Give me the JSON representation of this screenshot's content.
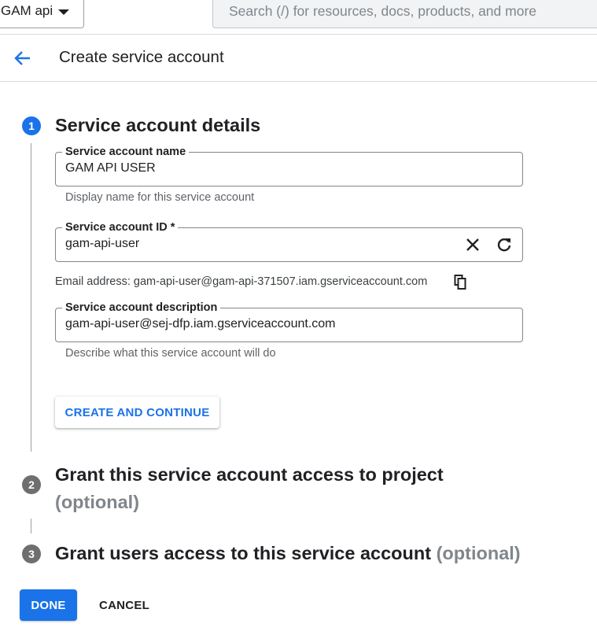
{
  "topbar": {
    "project_name": "GAM api",
    "search_placeholder": "Search (/) for resources, docs, products, and more"
  },
  "header": {
    "title": "Create service account"
  },
  "steps": [
    {
      "number": "1",
      "title": "Service account details"
    },
    {
      "number": "2",
      "title": "Grant this service account access to project",
      "optional": "(optional)"
    },
    {
      "number": "3",
      "title": "Grant users access to this service account",
      "optional": "(optional)"
    }
  ],
  "form": {
    "name": {
      "label": "Service account name",
      "value": "GAM API USER",
      "helper": "Display name for this service account"
    },
    "id": {
      "label": "Service account ID *",
      "value": "gam-api-user"
    },
    "email_line": "Email address: gam-api-user@gam-api-371507.iam.gserviceaccount.com",
    "description": {
      "label": "Service account description",
      "value": "gam-api-user@sej-dfp.iam.gserviceaccount.com",
      "helper": "Describe what this service account will do"
    },
    "create_button": "CREATE AND CONTINUE"
  },
  "footer": {
    "done_label": "DONE",
    "cancel_label": "CANCEL"
  },
  "icons": {
    "back": "arrow-back-icon",
    "clear": "close-icon",
    "refresh": "refresh-icon",
    "copy": "copy-icon",
    "dropdown": "caret-down-icon"
  },
  "colors": {
    "accent": "#1a73e8",
    "step_inactive": "#6f6f6f",
    "muted_text": "#80868b"
  }
}
